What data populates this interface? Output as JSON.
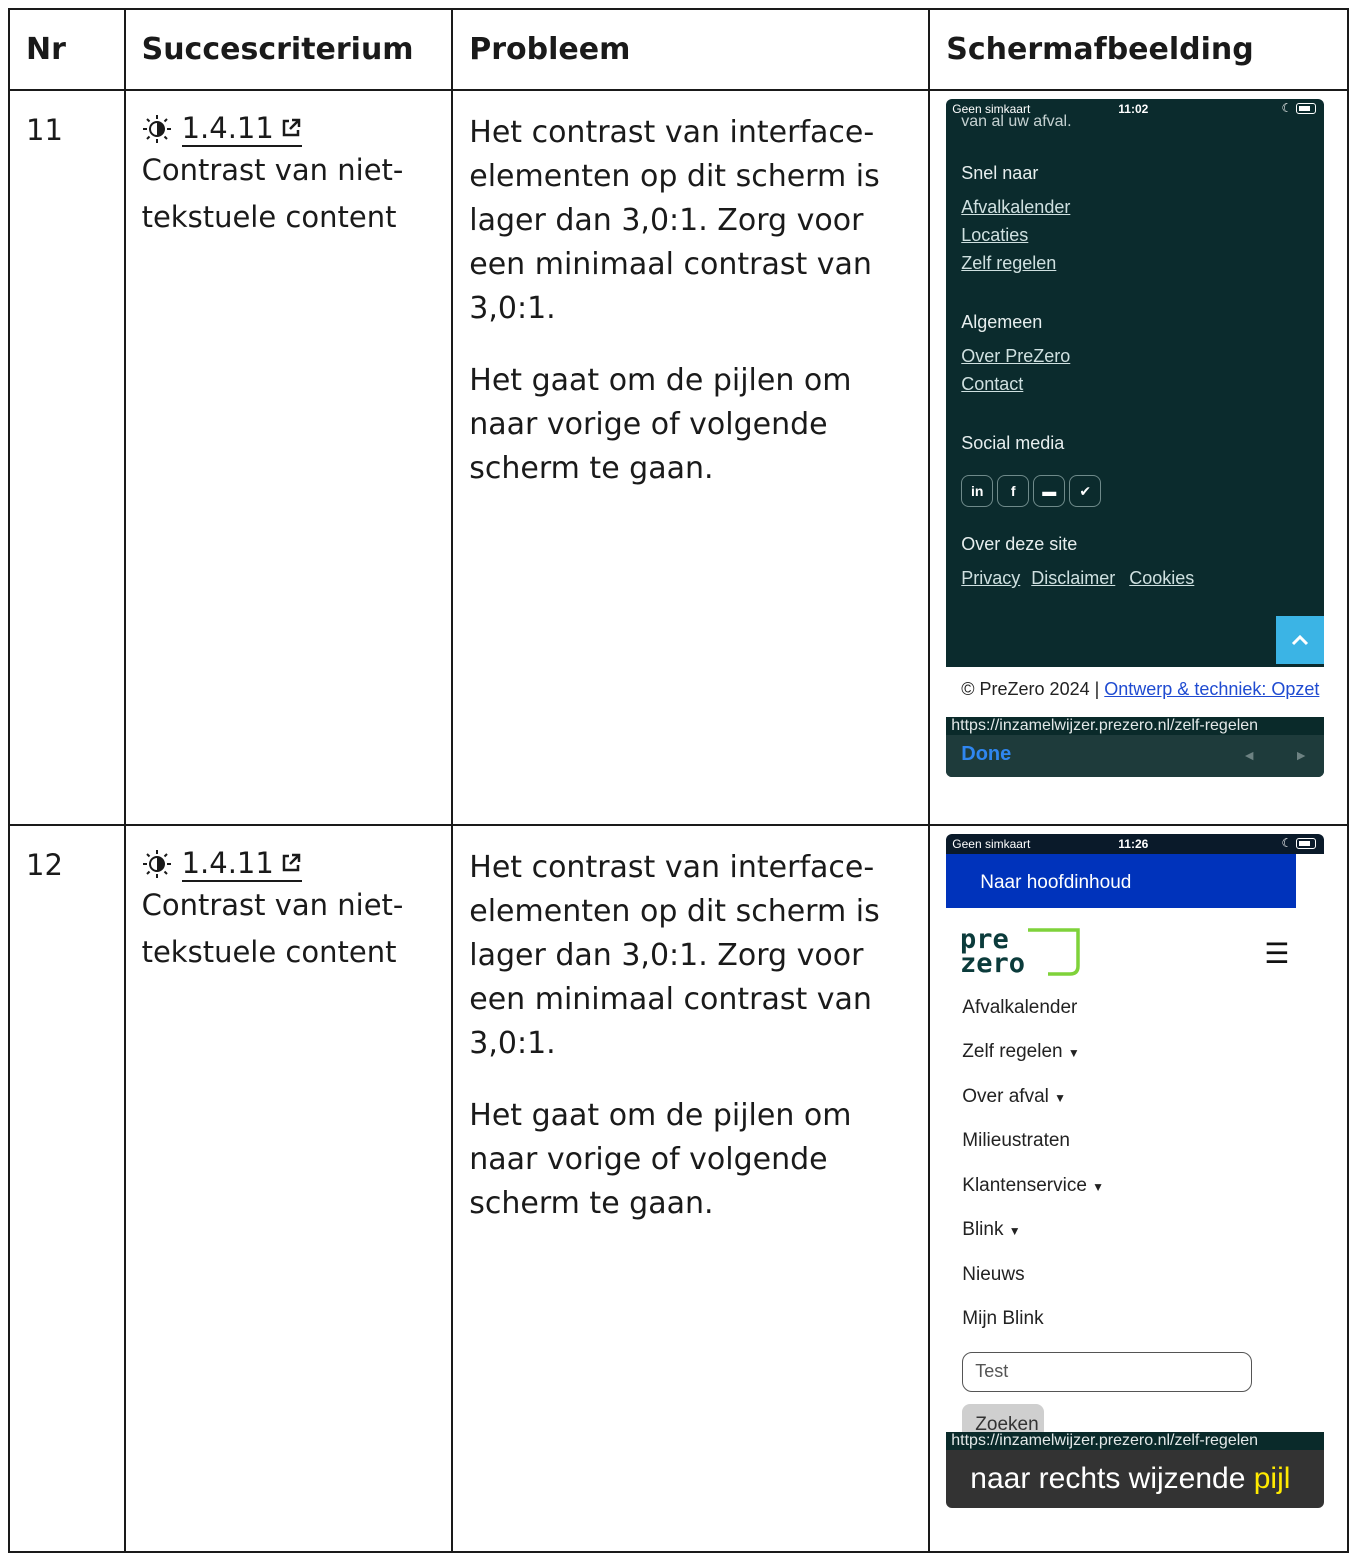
{
  "table": {
    "headers": [
      "Nr",
      "Succescriterium",
      "Probleem",
      "Schermafbeelding"
    ],
    "rows": [
      {
        "nr": "11",
        "criterion_code": "1.4.11",
        "criterion_name": "Contrast van niet-tekstuele content",
        "problem_p1": "Het contrast van interface-elementen op dit scherm is lager dan 3,0:1. Zorg voor een minimaal contrast van 3,0:1.",
        "problem_p2": "Het gaat om de pijlen om naar vorige of volgende scherm te gaan.",
        "screenshot": {
          "status_carrier": "Geen simkaart",
          "status_time": "11:02",
          "cut_text": "van al uw afval.",
          "heading_snel": "Snel naar",
          "links_snel": [
            "Afvalkalender",
            "Locaties",
            "Zelf regelen"
          ],
          "heading_algemeen": "Algemeen",
          "links_algemeen": [
            "Over PreZero",
            "Contact"
          ],
          "heading_social": "Social media",
          "social_icons": [
            "linkedin-icon",
            "facebook-icon",
            "youtube-icon",
            "twitter-icon"
          ],
          "heading_over": "Over deze site",
          "links_over": [
            "Privacy",
            "Disclaimer",
            "Cookies"
          ],
          "footer_text": "© PreZero 2024 | ",
          "footer_link": "Ontwerp & techniek: Opzet",
          "url": "https://inzamelwijzer.prezero.nl/zelf-regelen",
          "done_label": "Done"
        }
      },
      {
        "nr": "12",
        "criterion_code": "1.4.11",
        "criterion_name": "Contrast van niet-tekstuele content",
        "problem_p1": "Het contrast van interface-elementen op dit scherm is lager dan 3,0:1. Zorg voor een minimaal contrast van 3,0:1.",
        "problem_p2": "Het gaat om de pijlen om naar vorige of volgende scherm te gaan.",
        "screenshot": {
          "status_carrier": "Geen simkaart",
          "status_time": "11:26",
          "skip_link": "Naar hoofdinhoud",
          "logo_top": "pre",
          "logo_bottom": "zero",
          "menu_items": [
            "Afvalkalender",
            "Zelf regelen",
            "Over afval",
            "Milieustraten",
            "Klantenservice",
            "Blink",
            "Nieuws",
            "Mijn Blink"
          ],
          "search_value": "Test",
          "search_button": "Zoeken",
          "url": "https://inzamelwijzer.prezero.nl/zelf-regelen",
          "voice_text": "naar rechts wijzende ",
          "voice_highlight": "pijl"
        }
      }
    ]
  }
}
